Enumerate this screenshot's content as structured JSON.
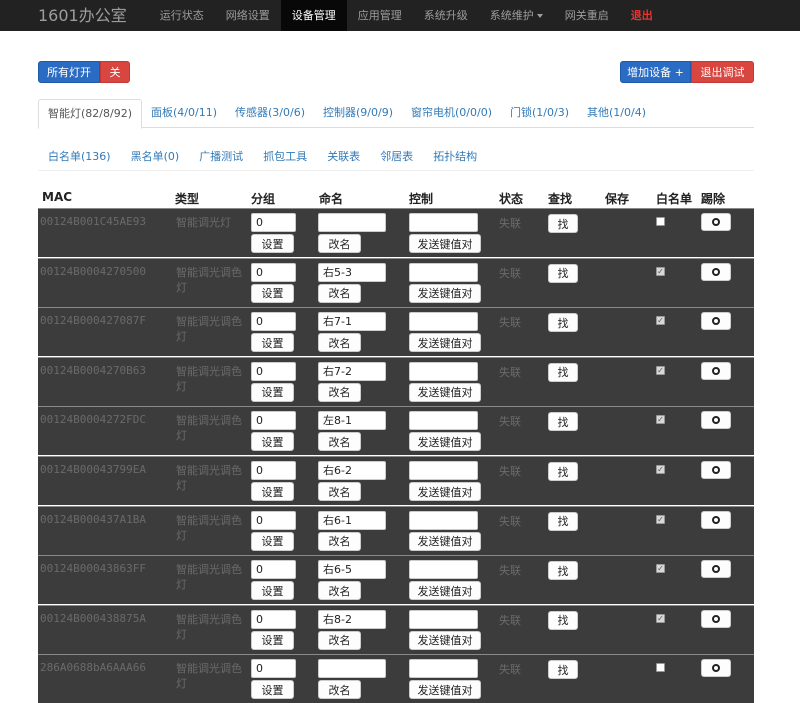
{
  "navbar": {
    "brand": "1601办公室",
    "items": [
      "运行状态",
      "网络设置",
      "设备管理",
      "应用管理",
      "系统升级",
      "系统维护",
      "网关重启",
      "退出"
    ],
    "active_index": 2
  },
  "actions": {
    "all_on": "所有灯开",
    "off": "关",
    "add_device": "增加设备 +",
    "exit_debug": "退出调试"
  },
  "tabs": [
    "智能灯(82/8/92)",
    "面板(4/0/11)",
    "传感器(3/0/6)",
    "控制器(9/0/9)",
    "窗帘电机(0/0/0)",
    "门锁(1/0/3)",
    "其他(1/0/4)"
  ],
  "subtabs": [
    "白名单(136)",
    "黑名单(0)",
    "广播测试",
    "抓包工具",
    "关联表",
    "邻居表",
    "拓扑结构"
  ],
  "table": {
    "headers": [
      "MAC",
      "类型",
      "分组",
      "命名",
      "控制",
      "状态",
      "查找",
      "保存",
      "白名单",
      "踢除"
    ],
    "set_label": "设置",
    "rename_label": "改名",
    "send_label": "发送键值对",
    "find_label": "找",
    "rows": [
      {
        "mac": "00124B001C45AE93",
        "type": "智能调光灯",
        "group": "0",
        "name": "",
        "status": "失联",
        "whitelisted": false
      },
      {
        "mac": "00124B0004270500",
        "type": "智能调光调色灯",
        "group": "0",
        "name": "右5-3",
        "status": "失联",
        "whitelisted": true
      },
      {
        "mac": "00124B000427087F",
        "type": "智能调光调色灯",
        "group": "0",
        "name": "右7-1",
        "status": "失联",
        "whitelisted": true
      },
      {
        "mac": "00124B0004270B63",
        "type": "智能调光调色灯",
        "group": "0",
        "name": "右7-2",
        "status": "失联",
        "whitelisted": true
      },
      {
        "mac": "00124B0004272FDC",
        "type": "智能调光调色灯",
        "group": "0",
        "name": "左8-1",
        "status": "失联",
        "whitelisted": true
      },
      {
        "mac": "00124B00043799EA",
        "type": "智能调光调色灯",
        "group": "0",
        "name": "右6-2",
        "status": "失联",
        "whitelisted": true
      },
      {
        "mac": "00124B000437A1BA",
        "type": "智能调光调色灯",
        "group": "0",
        "name": "右6-1",
        "status": "失联",
        "whitelisted": true
      },
      {
        "mac": "00124B00043863FF",
        "type": "智能调光调色灯",
        "group": "0",
        "name": "右6-5",
        "status": "失联",
        "whitelisted": true
      },
      {
        "mac": "00124B000438875A",
        "type": "智能调光调色灯",
        "group": "0",
        "name": "右8-2",
        "status": "失联",
        "whitelisted": true
      },
      {
        "mac": "286A0688bA6AAA66",
        "type": "智能调光调色灯",
        "group": "0",
        "name": "",
        "status": "失联",
        "whitelisted": false
      }
    ]
  },
  "colors": {
    "navbar_bg": "#222222",
    "row_bg": "#3c3c3c",
    "primary": "#2a6bc4",
    "danger": "#d9453f",
    "link": "#337ab7",
    "logout": "#e8332f"
  }
}
